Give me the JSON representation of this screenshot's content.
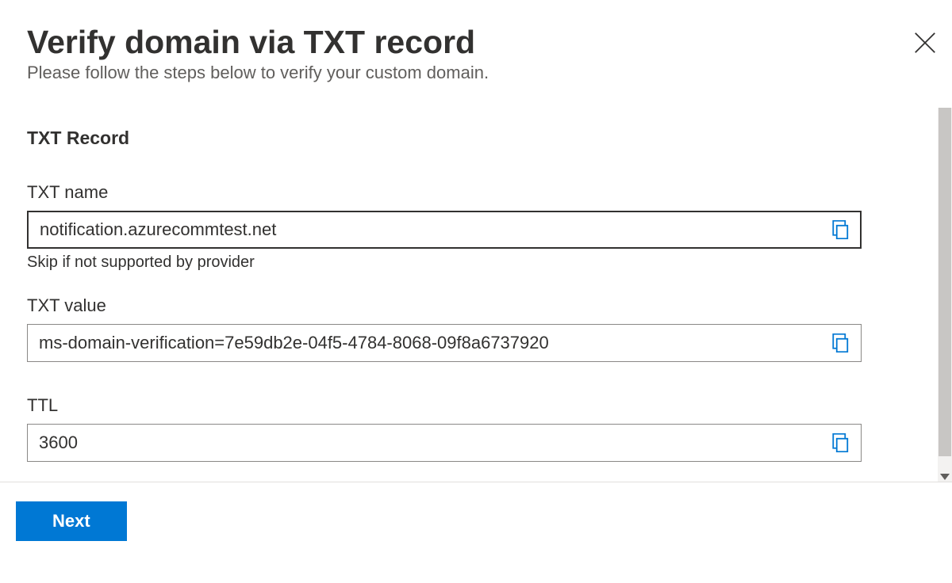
{
  "header": {
    "title": "Verify domain via TXT record",
    "subtitle": "Please follow the steps below to verify your custom domain."
  },
  "section": {
    "heading": "TXT Record"
  },
  "fields": {
    "txtName": {
      "label": "TXT name",
      "value": "notification.azurecommtest.net",
      "helper": "Skip if not supported by provider"
    },
    "txtValue": {
      "label": "TXT value",
      "value": "ms-domain-verification=7e59db2e-04f5-4784-8068-09f8a6737920"
    },
    "ttl": {
      "label": "TTL",
      "value": "3600"
    }
  },
  "buttons": {
    "next": "Next"
  },
  "colors": {
    "primary": "#0078d4"
  }
}
